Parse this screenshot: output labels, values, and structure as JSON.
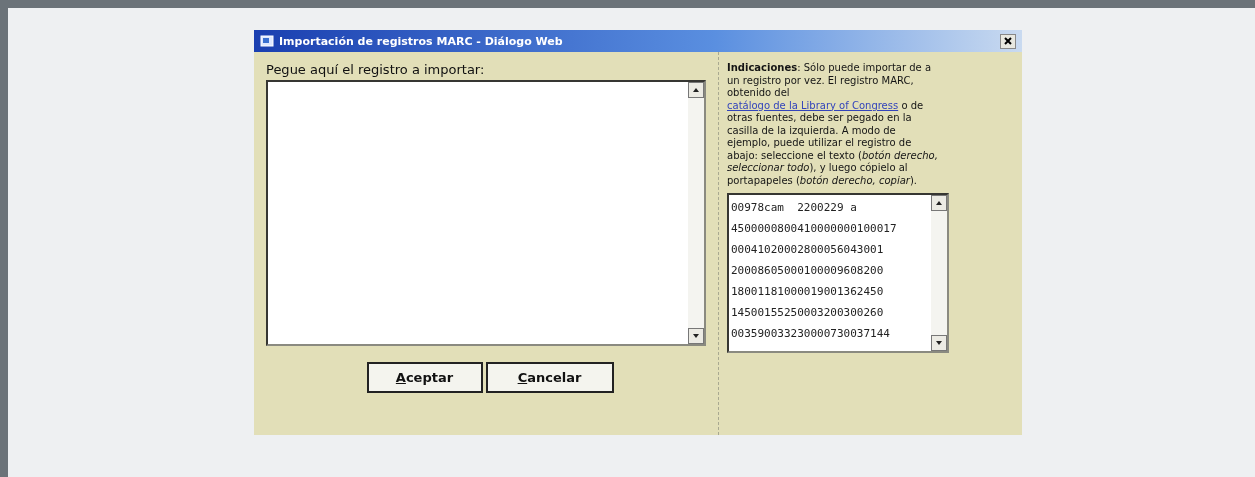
{
  "window": {
    "title": "Importación de registros MARC - Diálogo Web"
  },
  "paste_panel": {
    "label": "Pegue aquí el registro a importar:"
  },
  "buttons": [
    {
      "label": "Aceptar"
    },
    {
      "label": "Cancelar"
    }
  ],
  "instructions": {
    "before": "**Indicaciones**: Sólo puede importar de a un registro por vez. El registro MARC, obtenido del",
    "link": "catálogo de la Library of Congress",
    "after": "o de otras fuentes, debe ser pegado en la casilla de la izquierda. A modo de ejemplo, puede utilizar el registro de abajo: seleccione el texto (*botón derecho, seleccionar todo*), y luego cópielo al portapapeles (*botón derecho, copiar*)."
  },
  "sample_record": [
    "00978cam  2200229 a",
    "4500000800410000000100017",
    "00041020002800056043001",
    "20008605000100009608200",
    "18001181000019001362450",
    "14500155250003200300260",
    "003590033230000730037144"
  ]
}
